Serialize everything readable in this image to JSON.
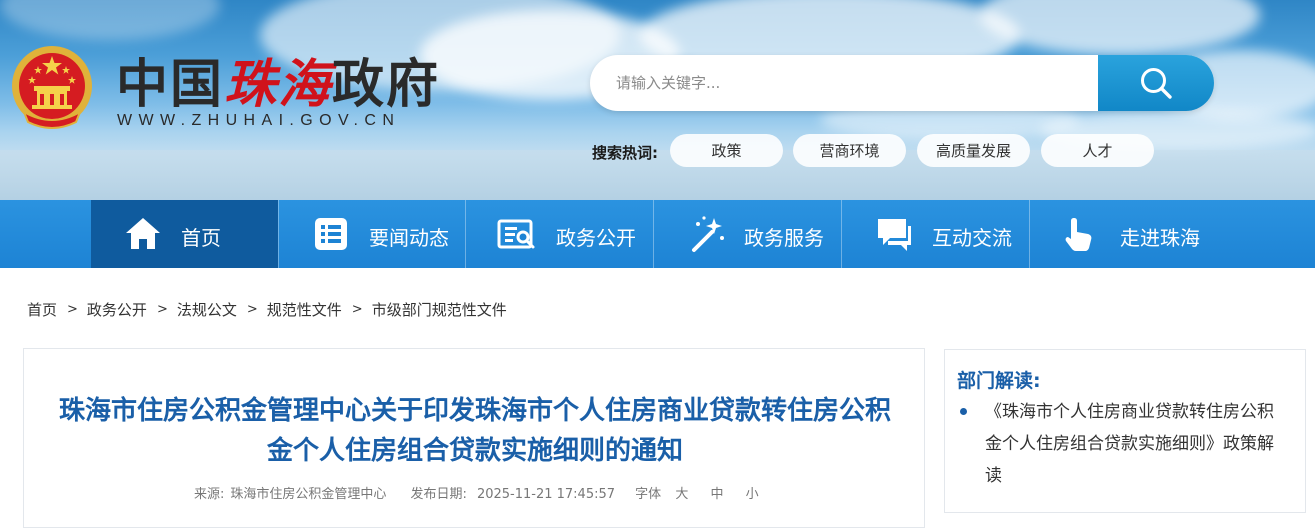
{
  "header": {
    "title_part1": "中国",
    "title_part2": "珠海",
    "title_part3": "政府",
    "domain": "WWW.ZHUHAI.GOV.CN",
    "search": {
      "placeholder": "请输入关键字..."
    },
    "hot_label": "搜索热词:",
    "hot_tags": [
      "政策",
      "营商环境",
      "高质量发展",
      "人才"
    ]
  },
  "nav": {
    "items": [
      {
        "label": "首页",
        "icon": "home-icon",
        "active": true
      },
      {
        "label": "要闻动态",
        "icon": "news-list-icon"
      },
      {
        "label": "政务公开",
        "icon": "document-search-icon"
      },
      {
        "label": "政务服务",
        "icon": "magic-wand-icon"
      },
      {
        "label": "互动交流",
        "icon": "chat-bubble-icon"
      },
      {
        "label": "走进珠海",
        "icon": "pointer-hand-icon"
      }
    ]
  },
  "breadcrumb": [
    "首页",
    "政务公开",
    "法规公文",
    "规范性文件",
    "市级部门规范性文件"
  ],
  "article": {
    "title_line1": "珠海市住房公积金管理中心关于印发珠海市个人住房商业贷款转住房公积",
    "title_line2": "金个人住房组合贷款实施细则的通知",
    "source_label": "来源:",
    "source": "珠海市住房公积金管理中心",
    "date_label": "发布日期:",
    "date": "2025-11-21 17:45:57",
    "font_label": "字体",
    "font_sizes": [
      "大",
      "中",
      "小"
    ]
  },
  "sidebar": {
    "title": "部门解读:",
    "link": "《珠海市个人住房商业贷款转住房公积金个人住房组合贷款实施细则》政策解读"
  },
  "colors": {
    "nav_blue": "#1d83d4",
    "nav_active": "#0f5b9e",
    "title_blue": "#1a5fa8",
    "brand_red": "#d0121b"
  }
}
